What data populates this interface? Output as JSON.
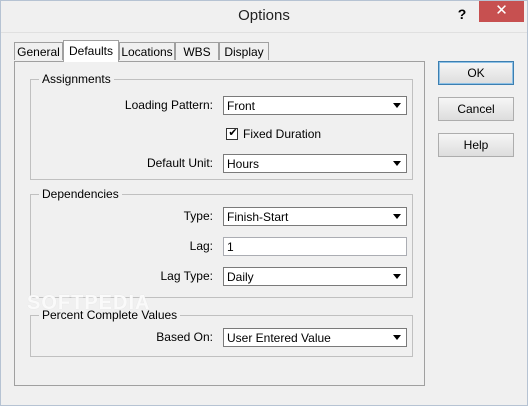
{
  "window": {
    "title": "Options",
    "help_glyph": "?",
    "close_glyph": "✕",
    "close_color": "#c75050"
  },
  "tabs": [
    {
      "label": "General",
      "active": false
    },
    {
      "label": "Defaults",
      "active": true
    },
    {
      "label": "Locations",
      "active": false
    },
    {
      "label": "WBS",
      "active": false
    },
    {
      "label": "Display",
      "active": false
    }
  ],
  "assignments": {
    "title": "Assignments",
    "loading_pattern_label": "Loading Pattern:",
    "loading_pattern_value": "Front",
    "fixed_duration_label": "Fixed Duration",
    "fixed_duration_checked": true,
    "check_glyph": "✔",
    "default_unit_label": "Default Unit:",
    "default_unit_value": "Hours"
  },
  "dependencies": {
    "title": "Dependencies",
    "type_label": "Type:",
    "type_value": "Finish-Start",
    "lag_label": "Lag:",
    "lag_value": "1",
    "lag_type_label": "Lag Type:",
    "lag_type_value": "Daily"
  },
  "percent_complete": {
    "title": "Percent Complete Values",
    "based_on_label": "Based On:",
    "based_on_value": "User Entered Value"
  },
  "buttons": {
    "ok": "OK",
    "cancel": "Cancel",
    "help": "Help"
  },
  "watermark": "SOFTPEDIA"
}
